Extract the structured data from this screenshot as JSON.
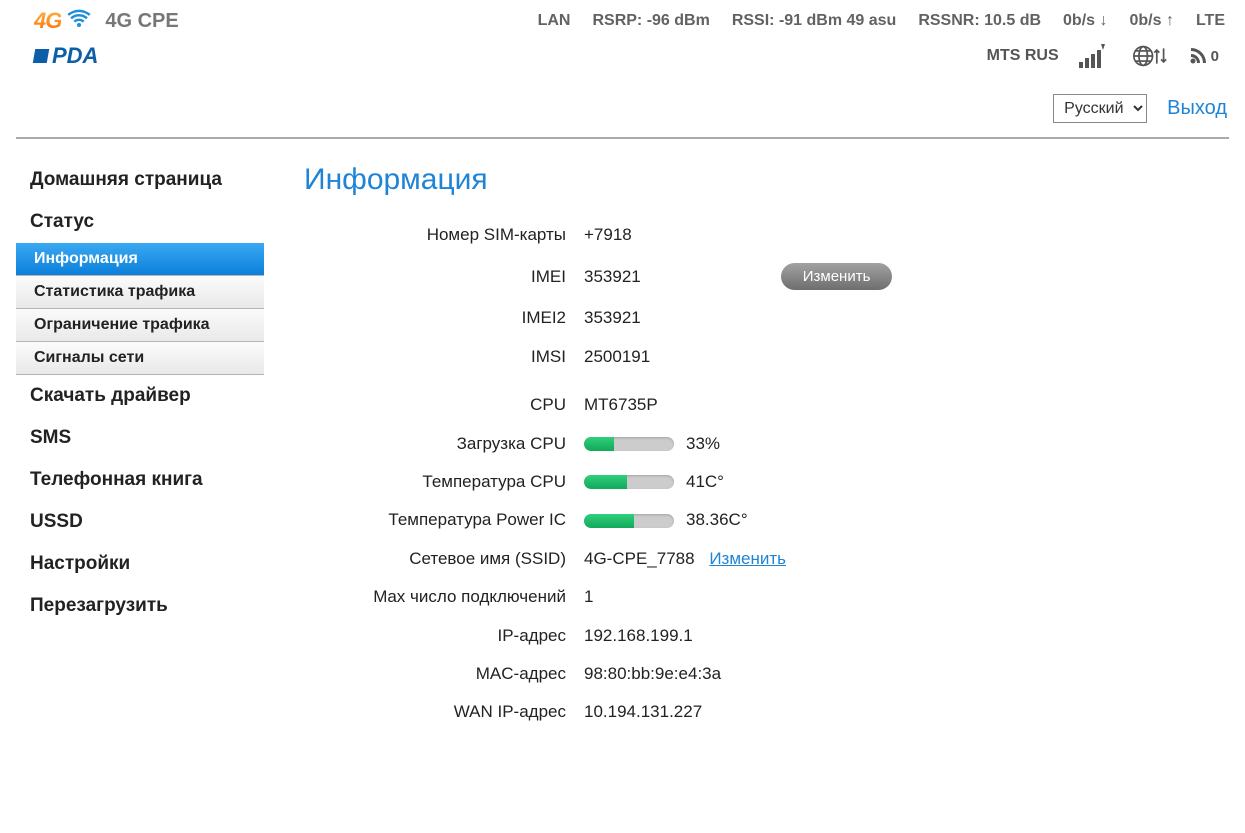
{
  "header": {
    "device_name": "4G CPE",
    "stats": {
      "lan": "LAN",
      "rsrp": "RSRP: -96 dBm",
      "rssi": "RSSI: -91 dBm 49 asu",
      "rssnr": "RSSNR: 10.5 dB",
      "down": "0b/s ↓",
      "up": "0b/s ↑",
      "mode": "LTE"
    },
    "carrier": "MTS RUS",
    "wifi_clients": "0"
  },
  "toolbar": {
    "language": "Русский",
    "logout": "Выход"
  },
  "sidebar": {
    "home": "Домашняя страница",
    "status": "Статус",
    "sub": {
      "info": "Информация",
      "traffic_stats": "Статистика трафика",
      "traffic_limit": "Ограничение трафика",
      "signals": "Сигналы сети"
    },
    "driver": "Скачать драйвер",
    "sms": "SMS",
    "phonebook": "Телефонная книга",
    "ussd": "USSD",
    "settings": "Настройки",
    "reboot": "Перезагрузить"
  },
  "page": {
    "title": "Информация",
    "labels": {
      "sim": "Номер SIM-карты",
      "imei": "IMEI",
      "imei2": "IMEI2",
      "imsi": "IMSI",
      "cpu": "CPU",
      "cpu_load": "Загрузка CPU",
      "cpu_temp": "Температура CPU",
      "pic_temp": "Температура Power IC",
      "ssid": "Сетевое имя (SSID)",
      "max_conn": "Max число подключений",
      "ip": "IP-адрес",
      "mac": "MAC-адрес",
      "wan_ip": "WAN IP-адрес"
    },
    "values": {
      "sim": "+7918",
      "imei": "353921",
      "imei2": "353921",
      "imsi": "2500191",
      "cpu": "MT6735P",
      "cpu_load_pct": 33,
      "cpu_load_text": "33%",
      "cpu_temp_pct": 48,
      "cpu_temp_text": "41C°",
      "pic_temp_pct": 55,
      "pic_temp_text": "38.36C°",
      "ssid": "4G-CPE_7788",
      "max_conn": "1",
      "ip": "192.168.199.1",
      "mac": "98:80:bb:9e:e4:3a",
      "wan_ip": "10.194.131.227"
    },
    "buttons": {
      "change_imei": "Изменить",
      "change_ssid": "Изменить"
    }
  }
}
